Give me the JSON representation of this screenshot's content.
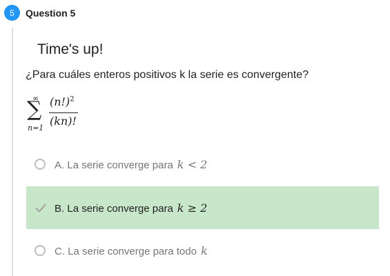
{
  "question": {
    "number": "5",
    "title": "Question 5",
    "status": "Time's up!",
    "prompt": "¿Para cuáles enteros positivos k la serie es convergente?"
  },
  "formula": {
    "sum_upper": "∞",
    "sum_symbol": "∑",
    "sum_lower": "n=1",
    "numerator": "(n!)",
    "numerator_exp": "2",
    "denominator": "(kn)!"
  },
  "options": [
    {
      "letter": "A.",
      "text": "La serie converge para",
      "math": "k < 2",
      "state": "unselected"
    },
    {
      "letter": "B.",
      "text": "La serie converge para",
      "math": "k ≥ 2",
      "state": "correct"
    },
    {
      "letter": "C.",
      "text": "La serie converge para todo",
      "math": "k",
      "state": "unselected"
    }
  ],
  "colors": {
    "badge": "#2196f3",
    "correct_bg": "#c8e6c9",
    "check": "#9e9e9e"
  }
}
